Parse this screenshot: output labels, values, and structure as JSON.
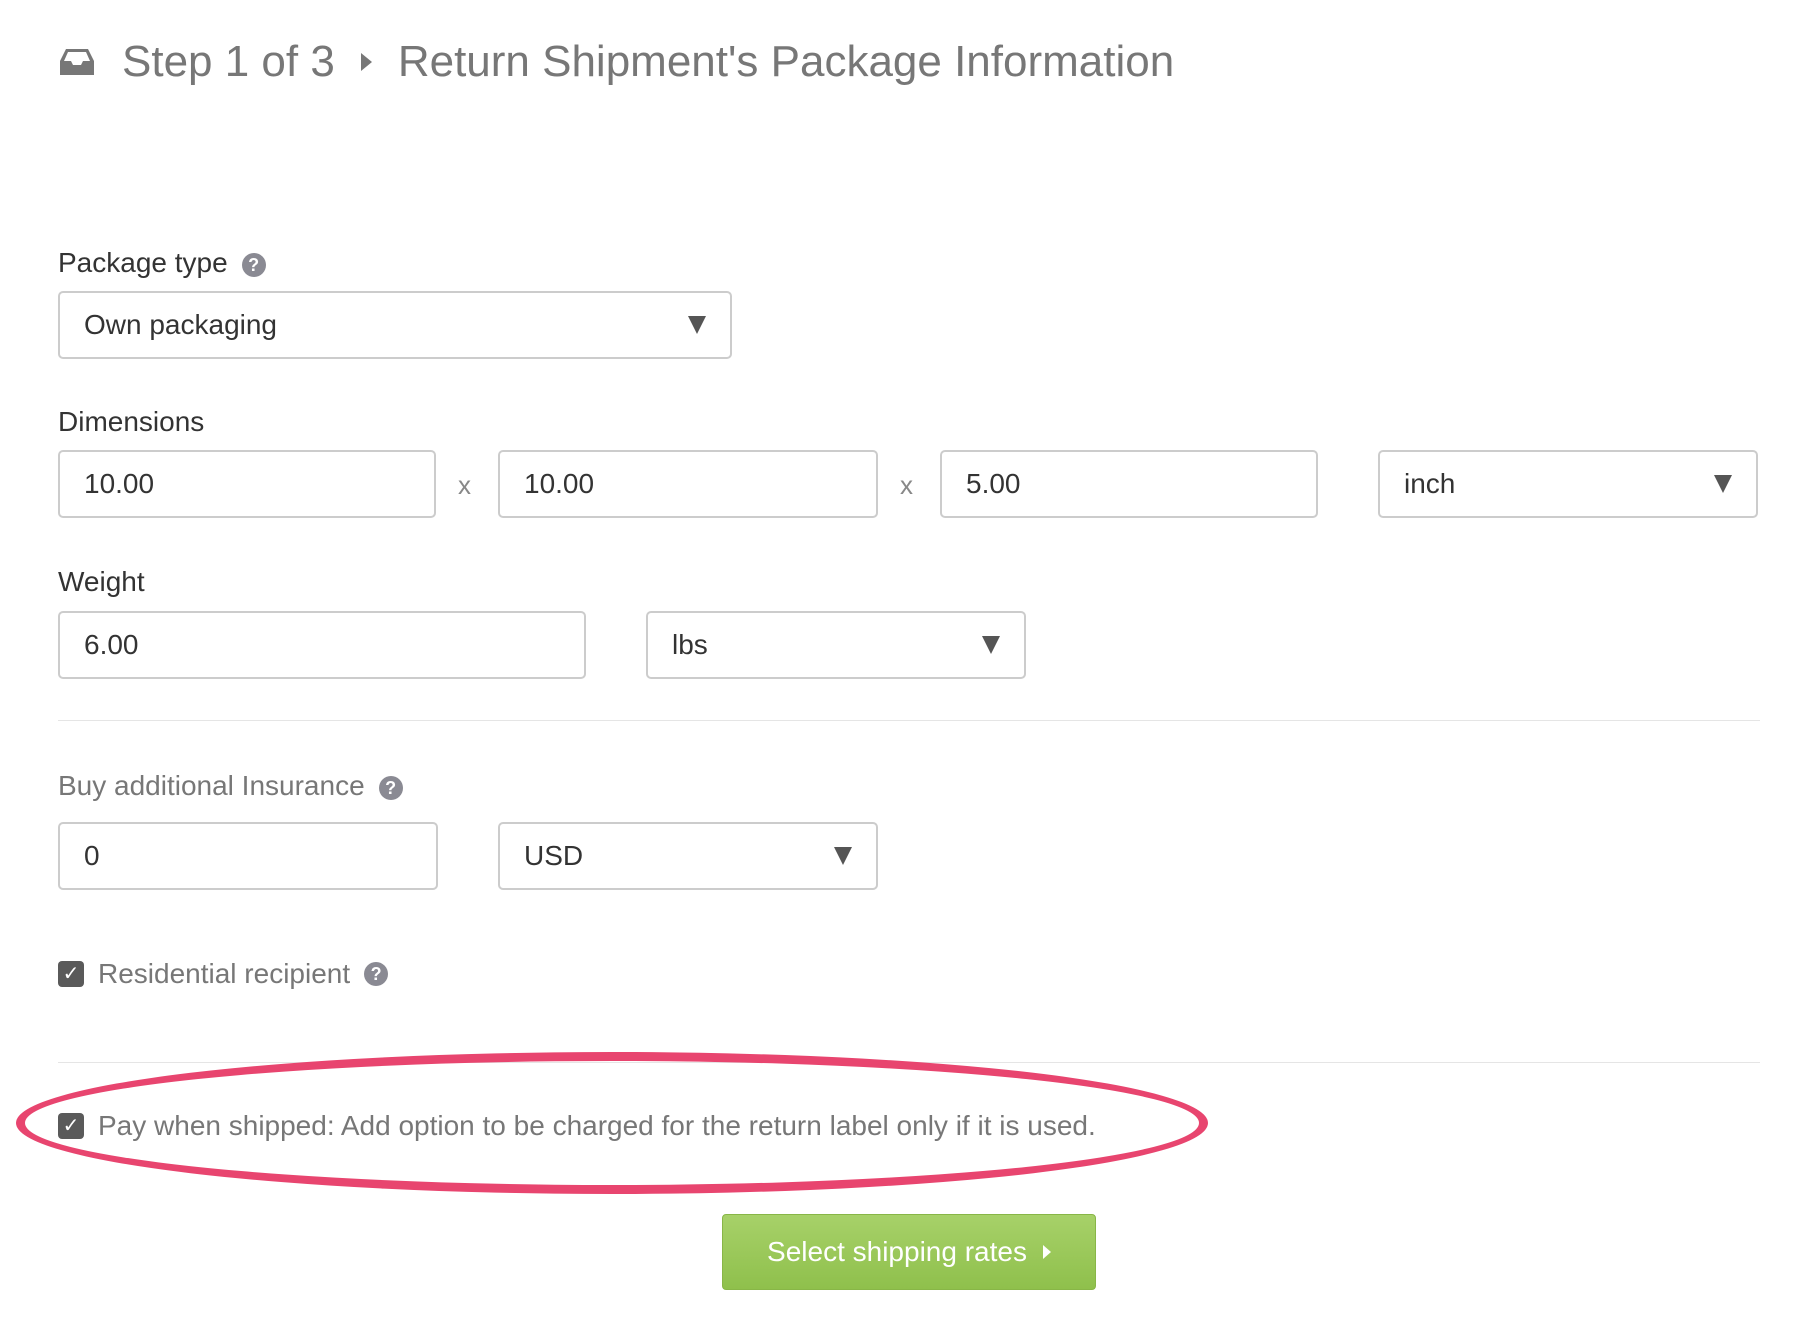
{
  "header": {
    "icon": "inbox-icon",
    "step": "Step 1 of 3",
    "title": "Return Shipment's Package Information"
  },
  "package_type": {
    "label": "Package type",
    "help_icon": "?",
    "value": "Own packaging"
  },
  "dimensions": {
    "label": "Dimensions",
    "length": "10.00",
    "width": "10.00",
    "height": "5.00",
    "separator": "x",
    "unit": "inch"
  },
  "weight": {
    "label": "Weight",
    "value": "6.00",
    "unit": "lbs"
  },
  "insurance": {
    "label": "Buy additional Insurance",
    "help_icon": "?",
    "value": "0",
    "currency": "USD"
  },
  "residential": {
    "label": "Residential recipient",
    "checked": true,
    "help_icon": "?"
  },
  "pay_when_shipped": {
    "label": "Pay when shipped: Add option to be charged for the return label only if it is used.",
    "checked": true,
    "highlight_color": "#e8456f"
  },
  "submit": {
    "label": "Select shipping rates",
    "color": "#96c654"
  }
}
